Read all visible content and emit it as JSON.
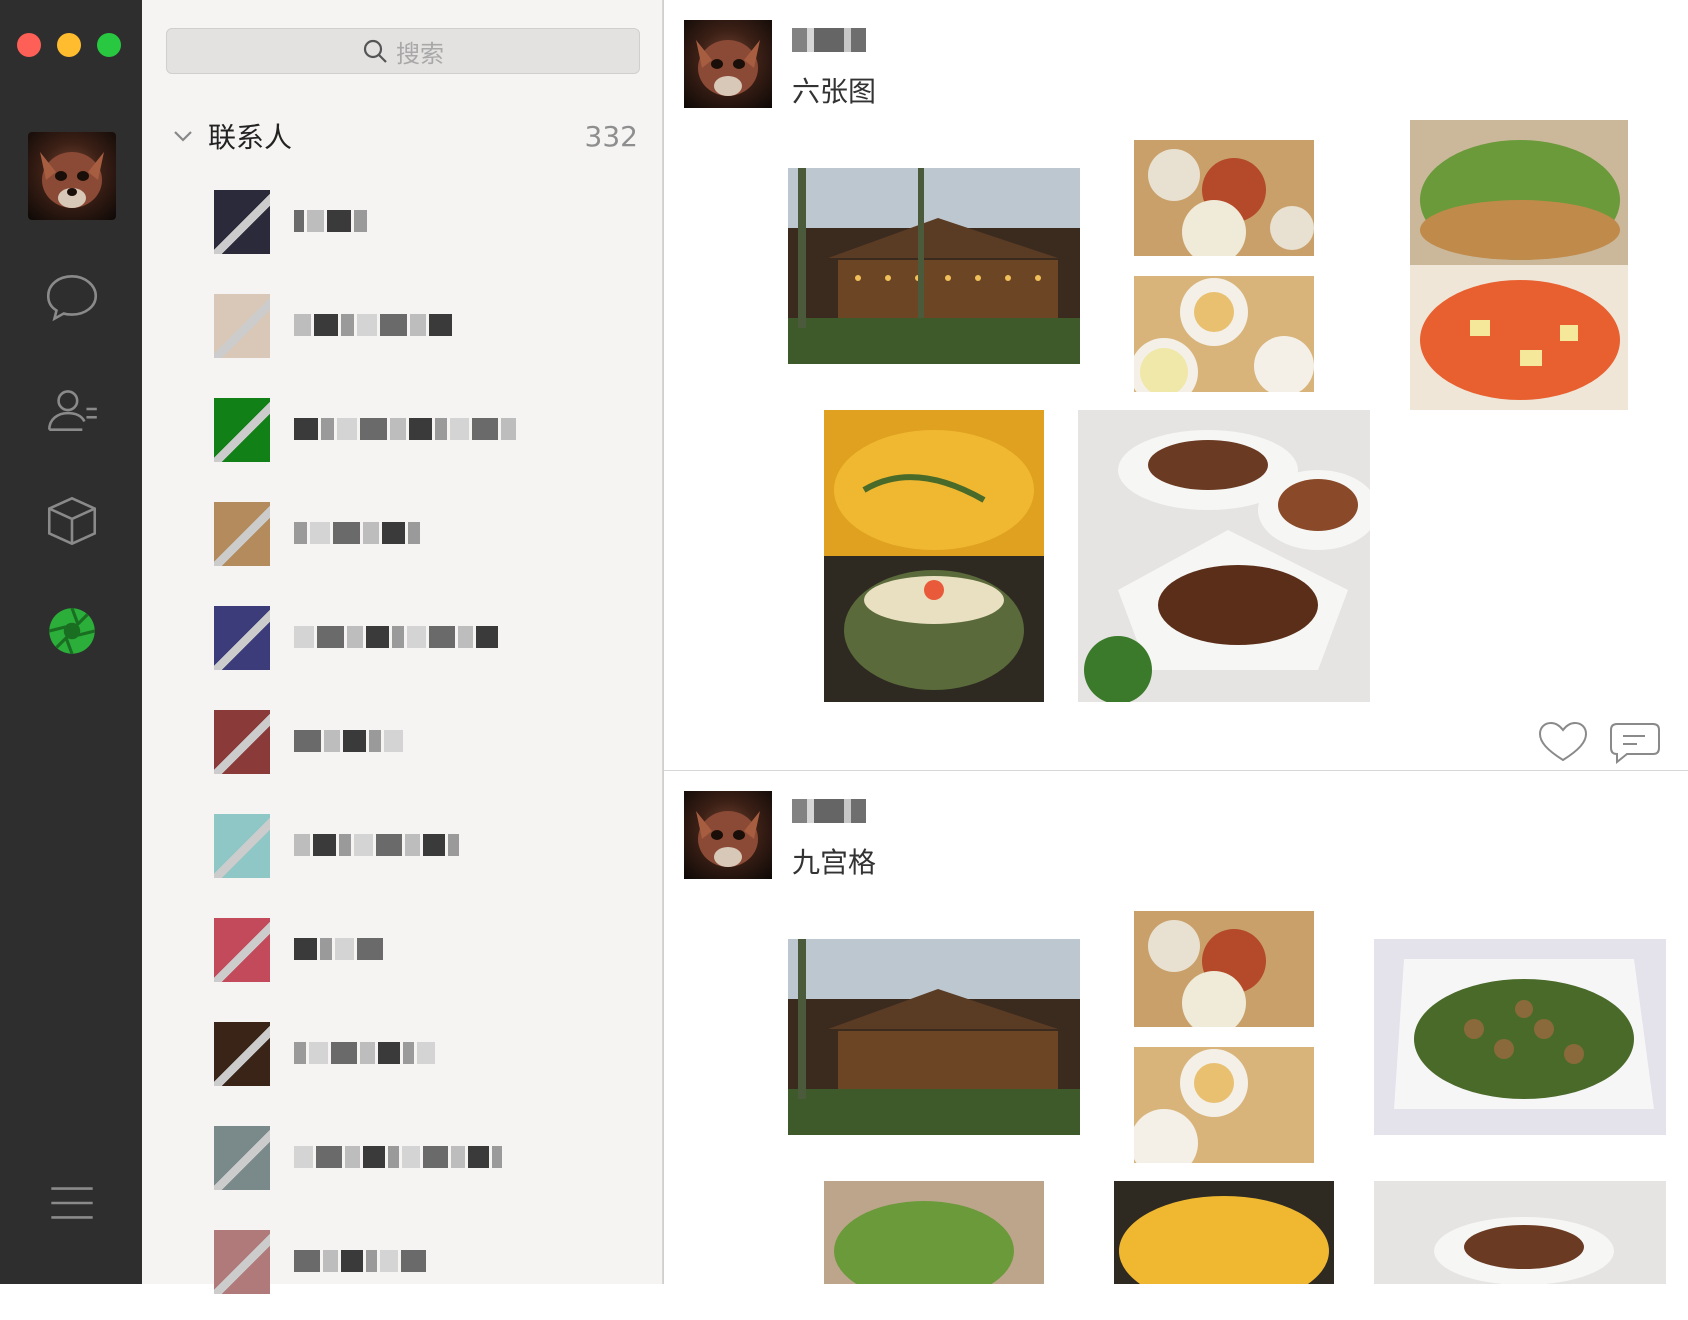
{
  "window": {
    "traffic_lights": [
      "close",
      "minimize",
      "maximize"
    ]
  },
  "rail": {
    "items": [
      {
        "name": "chat-bubble-icon"
      },
      {
        "name": "contacts-icon"
      },
      {
        "name": "cube-icon"
      },
      {
        "name": "moments-aperture-icon",
        "active": true,
        "color": "#2bae3a"
      },
      {
        "name": "menu-icon"
      }
    ]
  },
  "contacts": {
    "search_placeholder": "搜索",
    "group_title": "联系人",
    "group_count": "332",
    "items": [
      {
        "avatar_color": "#2a2a3a"
      },
      {
        "avatar_color": "#d9c7b8"
      },
      {
        "avatar_color": "#118016"
      },
      {
        "avatar_color": "#b48b5c"
      },
      {
        "avatar_color": "#3c3c7a"
      },
      {
        "avatar_color": "#8b3a3a"
      },
      {
        "avatar_color": "#8fc7c7"
      },
      {
        "avatar_color": "#c24a5a"
      },
      {
        "avatar_color": "#3a2418"
      },
      {
        "avatar_color": "#7a8a8a"
      },
      {
        "avatar_color": "#b07a7a"
      }
    ]
  },
  "feed": {
    "posts": [
      {
        "text": "六张图"
      },
      {
        "text": "九宫格"
      }
    ],
    "colors": {
      "restaurant": "#4d3a2a",
      "dumplings": "#c9a06a",
      "noodles": "#d8b47a",
      "salad": "#6a9a3a",
      "curry": "#e0a020",
      "pineapple": "#5a6a3a",
      "duck": "#6a3a22",
      "beans": "#6a7a3a"
    }
  }
}
